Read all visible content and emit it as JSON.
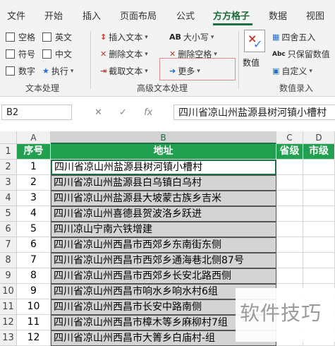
{
  "menu": {
    "tabs": [
      "文件",
      "开始",
      "插入",
      "页面布局",
      "公式",
      "方方格子",
      "数据",
      "视图"
    ],
    "active_tab": "方方格子"
  },
  "ribbon": {
    "text_processing": {
      "checkboxes": [
        "空格",
        "英文",
        "符号",
        "中文",
        "数字"
      ],
      "execute": "执行",
      "label": "文本处理"
    },
    "advanced_text": {
      "insert_text": "插入文本",
      "delete_text": "删除文本",
      "cut_text": "截取文本",
      "case": "大小写",
      "delete_spaces": "删除空格",
      "more": "更多",
      "label": "高级文本处理"
    },
    "data_entry": {
      "values": "数值",
      "round": "四舍五入",
      "keep_values": "只保留数值",
      "custom": "自定义",
      "label": "数值录入",
      "icon_labels": {
        "abc": "Abc",
        "ab": "AB"
      }
    }
  },
  "formula_bar": {
    "name_box": "B2",
    "fx": "fx",
    "content": "四川省凉山州盐源县树河镇小槽村"
  },
  "grid": {
    "columns": [
      "A",
      "B",
      "C",
      "D"
    ],
    "selected_column": "B",
    "header": {
      "seq": "序号",
      "address": "地址",
      "province": "省级",
      "city": "市级"
    },
    "rows": [
      {
        "row": "1"
      },
      {
        "row": "2",
        "seq": "1",
        "address": "四川省凉山州盐源县树河镇小槽村"
      },
      {
        "row": "3",
        "seq": "2",
        "address": "四川省凉山州盐源县白乌镇白乌村"
      },
      {
        "row": "4",
        "seq": "3",
        "address": "四川省凉山州盐源县大坡蒙古族乡吉米"
      },
      {
        "row": "5",
        "seq": "4",
        "address": "四川省凉山州喜德县贺波洛乡跃进"
      },
      {
        "row": "6",
        "seq": "5",
        "address": "四川凉山宁南六铁增建"
      },
      {
        "row": "7",
        "seq": "6",
        "address": "四川省凉山州西昌市西郊乡东南街东侧"
      },
      {
        "row": "8",
        "seq": "7",
        "address": "四川省凉山州西昌市西郊乡通海巷北侧87号"
      },
      {
        "row": "9",
        "seq": "8",
        "address": "四川省凉山州西昌市西郊乡长安北路西侧"
      },
      {
        "row": "10",
        "seq": "9",
        "address": "四川省凉山州西昌市响水乡响水村6组"
      },
      {
        "row": "11",
        "seq": "10",
        "address": "四川省凉山州西昌市长安中路南侧"
      },
      {
        "row": "12",
        "seq": "11",
        "address": "四川省凉山州西昌市樟木等乡麻柳村7组"
      },
      {
        "row": "13",
        "seq": "12",
        "address": "四川省凉山州西昌市大箐乡白庙村-组"
      }
    ]
  },
  "watermark": "软件技巧"
}
